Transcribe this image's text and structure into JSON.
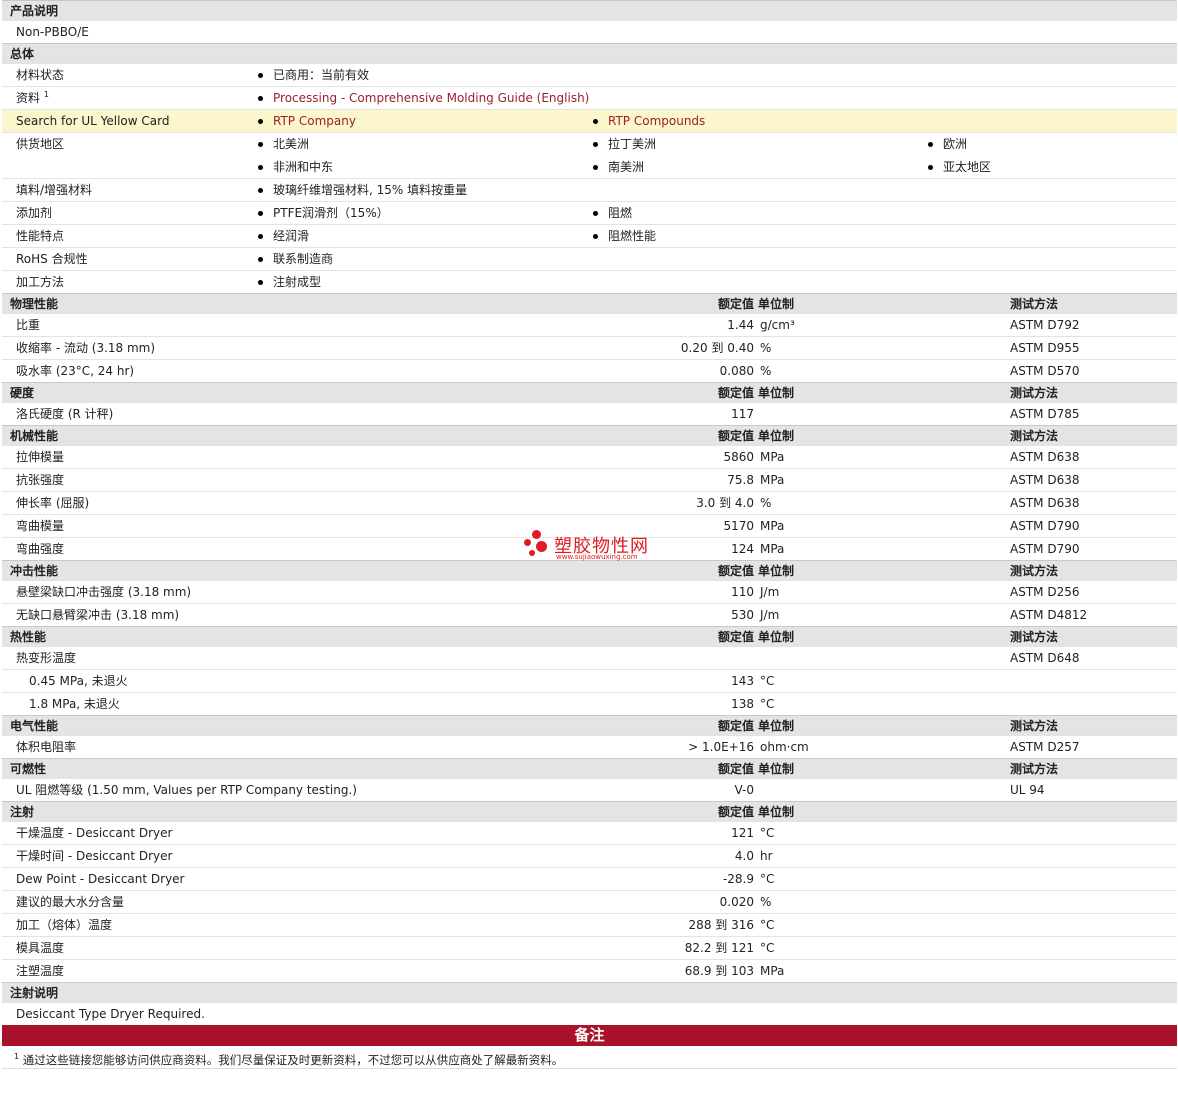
{
  "sections": {
    "desc": "产品说明",
    "general": "总体",
    "physical": "物理性能",
    "hardness": "硬度",
    "mechanical": "机械性能",
    "impact": "冲击性能",
    "thermal": "热性能",
    "electrical": "电气性能",
    "flammability": "可燃性",
    "injection": "注射",
    "injection_notes": "注射说明"
  },
  "col_headers": {
    "value": "额定值",
    "unit": "单位制",
    "method": "测试方法"
  },
  "product_desc": "Non-PBBO/E",
  "general": {
    "status_label": "材料状态",
    "status_value": "已商用：当前有效",
    "docs_label": "资料",
    "docs_sup": "1",
    "docs_link": "Processing - Comprehensive Molding Guide (English)",
    "ul_label": "Search for UL Yellow Card",
    "ul_link1": "RTP Company",
    "ul_link2": "RTP Compounds",
    "supply_label": "供货地区",
    "supply": [
      "北美洲",
      "拉丁美洲",
      "欧洲",
      "非洲和中东",
      "南美洲",
      "亚太地区"
    ],
    "filler_label": "填料/增强材料",
    "filler_value": "玻璃纤维增强材料, 15% 填料按重量",
    "additive_label": "添加剂",
    "additives": [
      "PTFE润滑剂（15%）",
      "阻燃"
    ],
    "features_label": "性能特点",
    "features": [
      "经润滑",
      "阻燃性能"
    ],
    "rohs_label": "RoHS 合规性",
    "rohs_value": "联系制造商",
    "process_label": "加工方法",
    "process_value": "注射成型"
  },
  "physical": [
    {
      "label": "比重",
      "value": "1.44",
      "unit": "g/cm³",
      "method": "ASTM D792"
    },
    {
      "label": "收缩率 - 流动 (3.18 mm)",
      "value": "0.20 到 0.40",
      "unit": "%",
      "method": "ASTM D955"
    },
    {
      "label": "吸水率 (23°C, 24 hr)",
      "value": "0.080",
      "unit": "%",
      "method": "ASTM D570"
    }
  ],
  "hardness": [
    {
      "label": "洛氏硬度 (R 计秤)",
      "value": "117",
      "unit": "",
      "method": "ASTM D785"
    }
  ],
  "mechanical": [
    {
      "label": "拉伸模量",
      "value": "5860",
      "unit": "MPa",
      "method": "ASTM D638"
    },
    {
      "label": "抗张强度",
      "value": "75.8",
      "unit": "MPa",
      "method": "ASTM D638"
    },
    {
      "label": "伸长率 (屈服)",
      "value": "3.0 到 4.0",
      "unit": "%",
      "method": "ASTM D638"
    },
    {
      "label": "弯曲模量",
      "value": "5170",
      "unit": "MPa",
      "method": "ASTM D790"
    },
    {
      "label": "弯曲强度",
      "value": "124",
      "unit": "MPa",
      "method": "ASTM D790"
    }
  ],
  "impact": [
    {
      "label": "悬壁梁缺口冲击强度 (3.18 mm)",
      "value": "110",
      "unit": "J/m",
      "method": "ASTM D256"
    },
    {
      "label": "无缺口悬臂梁冲击 (3.18 mm)",
      "value": "530",
      "unit": "J/m",
      "method": "ASTM D4812"
    }
  ],
  "thermal": {
    "hdt_label": "热变形温度",
    "hdt_method": "ASTM D648",
    "rows": [
      {
        "label": "0.45 MPa, 未退火",
        "value": "143",
        "unit": "°C"
      },
      {
        "label": "1.8 MPa, 未退火",
        "value": "138",
        "unit": "°C"
      }
    ]
  },
  "electrical": [
    {
      "label": "体积电阻率",
      "value": "> 1.0E+16",
      "unit": "ohm·cm",
      "method": "ASTM D257"
    }
  ],
  "flammability": [
    {
      "label": "UL 阻燃等级 (1.50 mm, Values per RTP Company testing.)",
      "value": "V-0",
      "unit": "",
      "method": "UL 94"
    }
  ],
  "injection": [
    {
      "label": "干燥温度 - Desiccant Dryer",
      "value": "121",
      "unit": "°C"
    },
    {
      "label": "干燥时间 - Desiccant Dryer",
      "value": "4.0",
      "unit": "hr"
    },
    {
      "label": "Dew Point - Desiccant Dryer",
      "value": "-28.9",
      "unit": "°C"
    },
    {
      "label": "建议的最大水分含量",
      "value": "0.020",
      "unit": "%"
    },
    {
      "label": "加工（熔体）温度",
      "value": "288 到 316",
      "unit": "°C"
    },
    {
      "label": "模具温度",
      "value": "82.2 到 121",
      "unit": "°C"
    },
    {
      "label": "注塑温度",
      "value": "68.9 到 103",
      "unit": "MPa"
    }
  ],
  "injection_note": "Desiccant Type Dryer Required.",
  "notes_title": "备注",
  "footnote_num": "1",
  "footnote": "通过这些链接您能够访问供应商资料。我们尽量保证及时更新资料，不过您可以从供应商处了解最新资料。",
  "watermark": {
    "title": "塑胶物性网",
    "url": "www.sujiaowuxing.com",
    "color": "#e01b22"
  },
  "colors": {
    "link": "#9b1f2e",
    "section_bg": "#e4e4e4",
    "highlight_row": "#fbf6cc",
    "notes_bar": "#a8122a"
  }
}
